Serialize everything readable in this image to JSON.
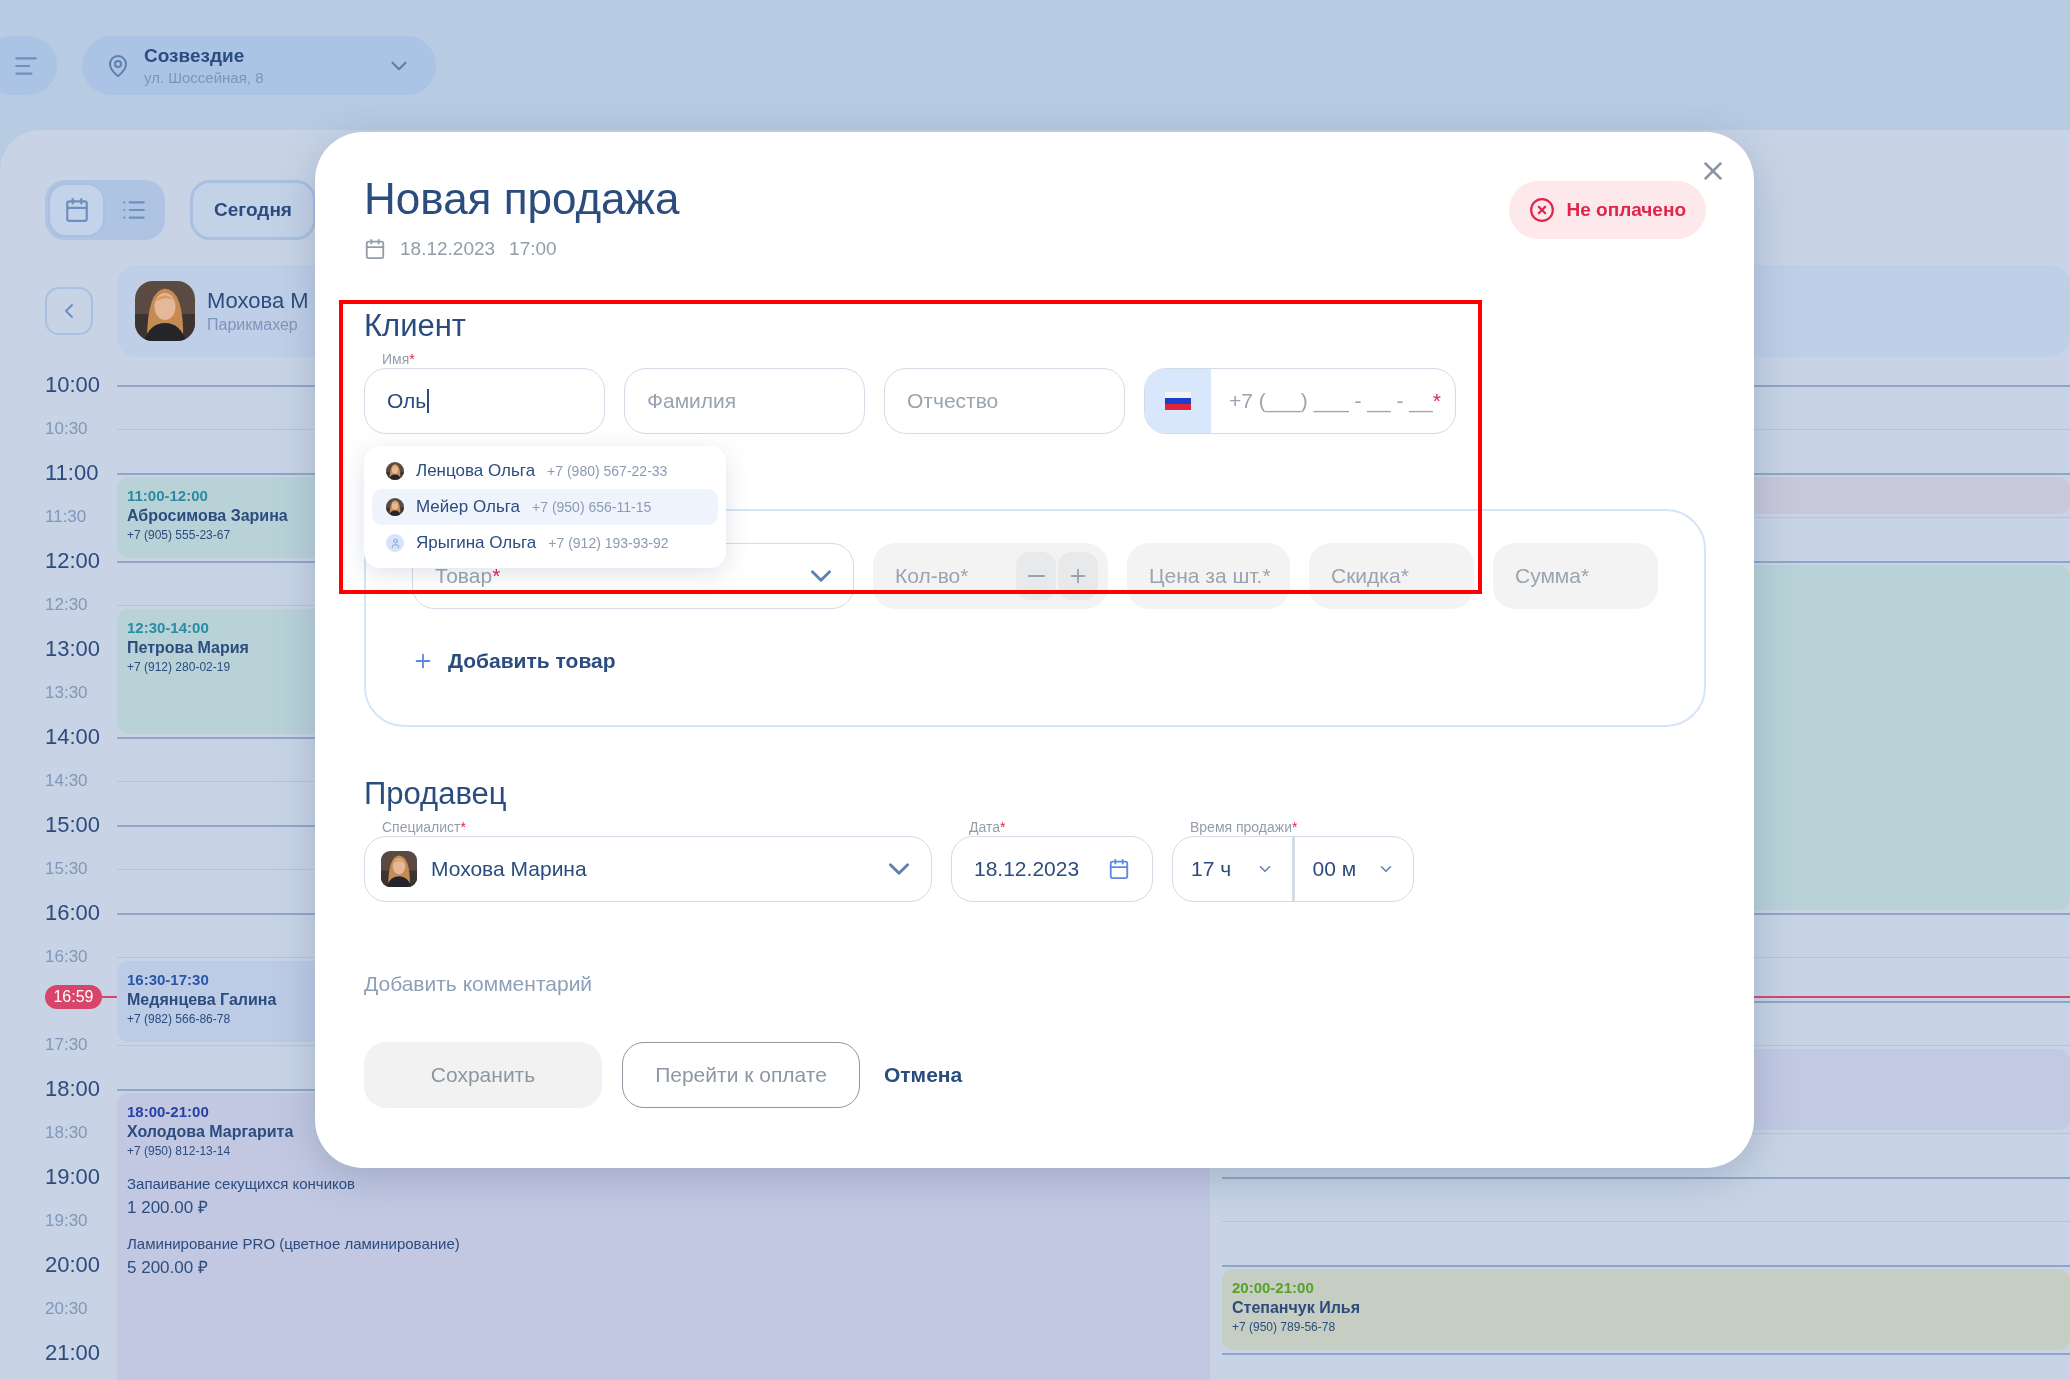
{
  "top_bar": {
    "location": {
      "name": "Созвездие",
      "address": "ул. Шоссейная, 8"
    }
  },
  "toolbar": {
    "views": [
      {
        "kind": "calendar",
        "selected": true
      },
      {
        "kind": "list",
        "selected": false
      }
    ],
    "today_button": "Сегодня"
  },
  "columns": [
    {
      "specialist": {
        "name": "Мохова М",
        "role": "Парикмахер"
      },
      "events": [
        {
          "time": "11:00-12:00",
          "name": "Абросимова Зарина",
          "phone": "+7 (905) 555-23-67",
          "color": "#b8d2d8"
        },
        {
          "time": "12:30-14:00",
          "name": "Петрова Мария",
          "phone": "+7 (912) 280-02-19",
          "color": "#b8d2d8"
        },
        {
          "time": "16:30-17:30",
          "name": "Медянцева Галина",
          "phone": "+7 (982) 566-86-78",
          "color": "#bccbe6"
        },
        {
          "time": "18:00-21:00",
          "name": "Холодова Маргарита",
          "phone": "+7 (950) 812-13-14",
          "color": "#c2c8e2",
          "services": [
            {
              "name": "Запаивание секущихся кончиков",
              "price": "1 200.00 ₽"
            },
            {
              "name": "Ламинирование PRO (цветное ламинирование)",
              "price": "5 200.00 ₽"
            }
          ]
        }
      ]
    },
    {
      "events": [
        {
          "color": "#c8c8da"
        },
        {
          "color": "#b8d2d8"
        },
        {
          "color": "#c2c9e3"
        },
        {
          "time": "20:00-21:00",
          "name": "Степанчук Илья",
          "phone": "+7 (950) 789-56-78",
          "color": "#c6cdc2"
        }
      ]
    }
  ],
  "time_slots": [
    {
      "label": "10:00",
      "kind": "hour"
    },
    {
      "label": "10:30",
      "kind": "half"
    },
    {
      "label": "11:00",
      "kind": "hour"
    },
    {
      "label": "11:30",
      "kind": "half"
    },
    {
      "label": "12:00",
      "kind": "hour"
    },
    {
      "label": "12:30",
      "kind": "half"
    },
    {
      "label": "13:00",
      "kind": "hour"
    },
    {
      "label": "13:30",
      "kind": "half"
    },
    {
      "label": "14:00",
      "kind": "hour"
    },
    {
      "label": "14:30",
      "kind": "half"
    },
    {
      "label": "15:00",
      "kind": "hour"
    },
    {
      "label": "15:30",
      "kind": "half"
    },
    {
      "label": "16:00",
      "kind": "hour"
    },
    {
      "label": "16:30",
      "kind": "half"
    },
    {
      "kind": "hour"
    },
    {
      "label": "17:30",
      "kind": "half"
    },
    {
      "label": "18:00",
      "kind": "hour"
    },
    {
      "label": "18:30",
      "kind": "half"
    },
    {
      "label": "19:00",
      "kind": "hour"
    },
    {
      "label": "19:30",
      "kind": "half"
    },
    {
      "label": "20:00",
      "kind": "hour"
    },
    {
      "label": "20:30",
      "kind": "half"
    },
    {
      "label": "21:00",
      "kind": "hour"
    }
  ],
  "now": "16:59",
  "modal": {
    "title": "Новая продажа",
    "date": "18.12.2023",
    "time": "17:00",
    "status": {
      "label": "Не оплачено",
      "paid": false
    },
    "client": {
      "heading": "Клиент",
      "fields": [
        {
          "label": "Имя",
          "required_mark": "*",
          "value": "Оль",
          "focused": true
        },
        {
          "placeholder": "Фамилия"
        },
        {
          "placeholder": "Отчество"
        }
      ],
      "phone": {
        "placeholder": "+7 (___) ___ - __ - __",
        "required_mark": "*"
      },
      "suggestions": [
        {
          "name": "Ленцова Ольга",
          "phone": "+7 (980) 567-22-33",
          "selected": false
        },
        {
          "name": "Мейер Ольга",
          "phone": "+7 (950) 656-11-15",
          "selected": true
        },
        {
          "name": "Ярыгина Ольга",
          "phone": "+7 (912) 193-93-92",
          "kind": "placeholder",
          "selected": false
        }
      ]
    },
    "products": {
      "product": {
        "placeholder": "Товар",
        "required_mark": "*"
      },
      "quantity": {
        "placeholder": "Кол-во*"
      },
      "price": {
        "placeholder": "Цена за шт.*"
      },
      "discount": {
        "placeholder": "Скидка*"
      },
      "sum": {
        "placeholder": "Сумма*"
      },
      "add": "Добавить товар"
    },
    "seller": {
      "heading": "Продавец",
      "specialist": {
        "label": "Специалист",
        "required_mark": "*",
        "value": "Мохова Марина"
      },
      "date": {
        "label": "Дата",
        "required_mark": "*",
        "value": "18.12.2023"
      },
      "time": {
        "label": "Время продажи",
        "required_mark": "*",
        "hours": "17 ч",
        "minutes": "00 м"
      }
    },
    "comment_link": "Добавить комментарий",
    "buttons": [
      {
        "label": "Сохранить",
        "kind": "primary",
        "disabled": true
      },
      {
        "label": "Перейти к оплате",
        "kind": "outline",
        "disabled": false
      },
      {
        "label": "Отмена",
        "kind": "text",
        "disabled": false
      }
    ]
  },
  "annotation": {
    "shown": true
  }
}
